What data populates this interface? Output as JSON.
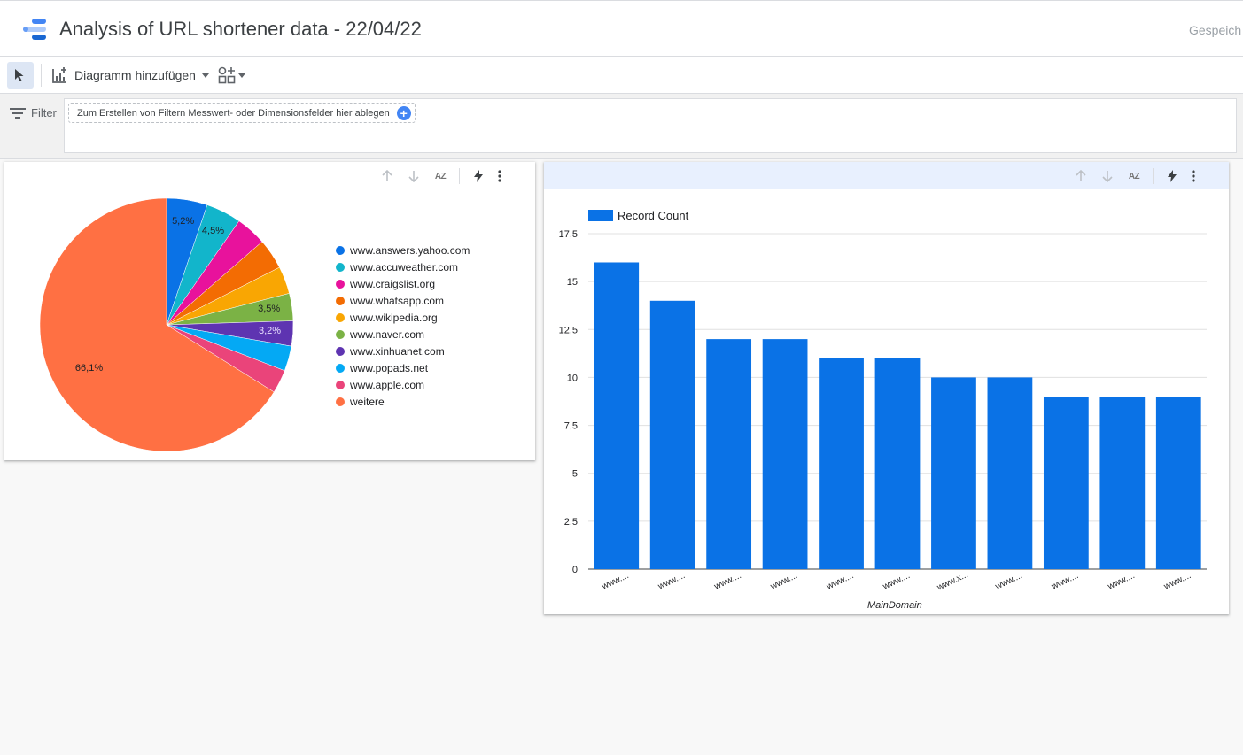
{
  "header": {
    "title": "Analysis of URL shortener data - 22/04/22",
    "saved_text": "Gespeich"
  },
  "toolbar": {
    "add_chart_label": "Diagramm hinzufügen"
  },
  "filterbar": {
    "label": "Filter",
    "drop_zone_text": "Zum Erstellen von Filtern Messwert- oder Dimensionsfelder hier ablegen",
    "plus": "+"
  },
  "chart_tools": {
    "sort_az": "AZ"
  },
  "chart_data": [
    {
      "type": "pie",
      "title": "",
      "legend_position": "right",
      "slices": [
        {
          "label": "www.answers.yahoo.com",
          "percent": 5.2,
          "value_label": "5,2%",
          "color": "#0a72e6"
        },
        {
          "label": "www.accuweather.com",
          "percent": 4.5,
          "value_label": "4,5%",
          "color": "#12b5cb"
        },
        {
          "label": "www.craigslist.org",
          "percent": 3.9,
          "value_label": "",
          "color": "#e8129c"
        },
        {
          "label": "www.whatsapp.com",
          "percent": 3.9,
          "value_label": "",
          "color": "#f36c03"
        },
        {
          "label": "www.wikipedia.org",
          "percent": 3.5,
          "value_label": "",
          "color": "#f9a603"
        },
        {
          "label": "www.naver.com",
          "percent": 3.5,
          "value_label": "3,5%",
          "color": "#7bb245"
        },
        {
          "label": "www.xinhuanet.com",
          "percent": 3.2,
          "value_label": "3,2%",
          "color": "#5e34b1"
        },
        {
          "label": "www.popads.net",
          "percent": 3.2,
          "value_label": "",
          "color": "#04a9f4"
        },
        {
          "label": "www.apple.com",
          "percent": 3.0,
          "value_label": "",
          "color": "#ea447a"
        },
        {
          "label": "weitere",
          "percent": 66.1,
          "value_label": "66,1%",
          "color": "#ff7043"
        }
      ]
    },
    {
      "type": "bar",
      "title": "",
      "legend": "Record Count",
      "legend_position": "top-left",
      "xlabel": "MainDomain",
      "ylabel": "",
      "ylim": [
        0,
        17.5
      ],
      "yticks": [
        "0",
        "2,5",
        "5",
        "7,5",
        "10",
        "12,5",
        "15",
        "17,5"
      ],
      "ytick_values": [
        0,
        2.5,
        5,
        7.5,
        10,
        12.5,
        15,
        17.5
      ],
      "grid": true,
      "color": "#0a72e6",
      "categories": [
        "www....",
        "www....",
        "www....",
        "www....",
        "www....",
        "www....",
        "www.x...",
        "www....",
        "www....",
        "www....",
        "www...."
      ],
      "values": [
        16,
        14,
        12,
        12,
        11,
        11,
        10,
        10,
        9,
        9,
        9
      ]
    }
  ]
}
